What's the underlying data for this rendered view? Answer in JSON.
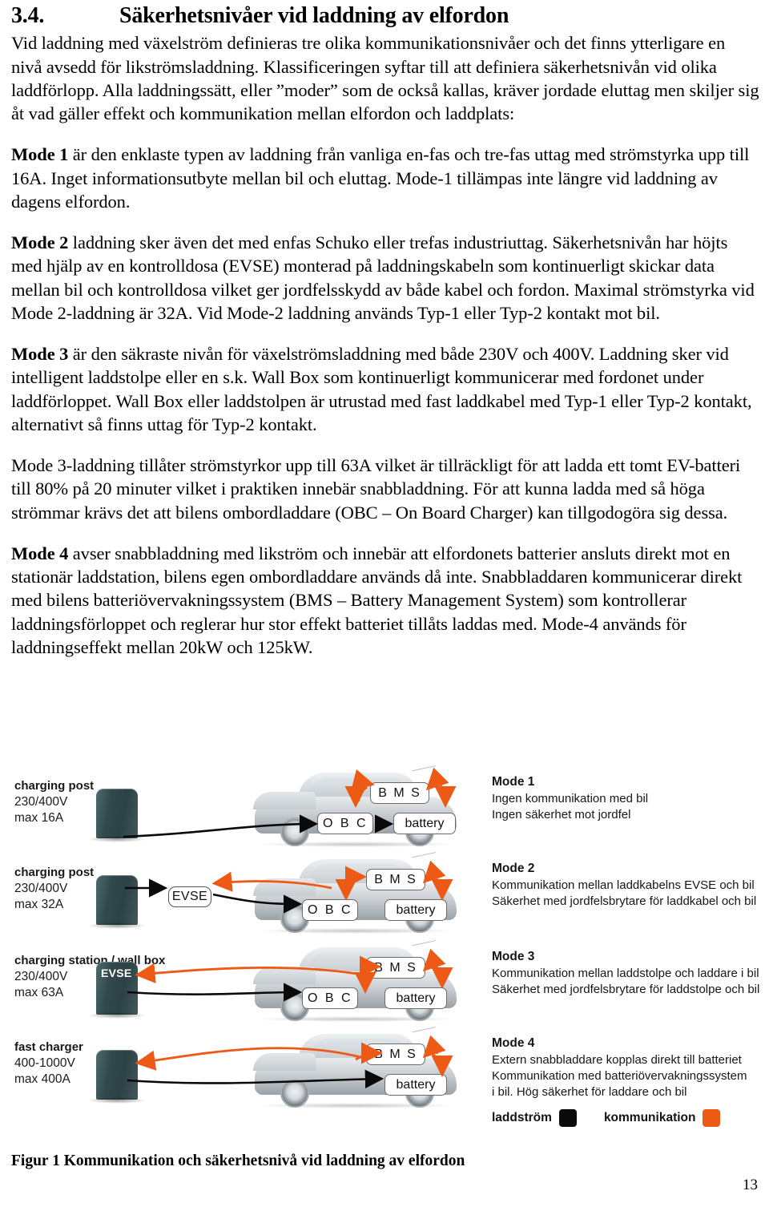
{
  "heading": {
    "number": "3.4.",
    "title": "Säkerhetsnivåer vid laddning av elfordon"
  },
  "body": {
    "intro": "Vid laddning med växelström definieras tre olika kommunikationsnivåer och det finns ytterligare en nivå avsedd för likströmsladdning. Klassificeringen syftar till att definiera säkerhetsnivån vid olika laddförlopp.  Alla laddningssätt, eller ”moder” som de också kallas, kräver jordade eluttag men skiljer sig åt vad gäller effekt och kommunikation mellan elfordon och laddplats:",
    "mode1_label": "Mode 1",
    "mode1_text": " är den enklaste typen av laddning från vanliga en-fas och tre-fas uttag med strömstyrka upp till 16A. Inget informationsutbyte mellan bil och eluttag. Mode-1 tillämpas inte längre vid laddning av dagens elfordon.",
    "mode2_label": "Mode 2",
    "mode2_text": " laddning sker även det med enfas Schuko eller trefas industriuttag. Säkerhetsnivån har höjts med hjälp av en kontrolldosa (EVSE) monterad på laddningskabeln som kontinuerligt skickar data mellan bil och kontrolldosa vilket ger jordfelsskydd av både kabel och fordon. Maximal strömstyrka vid Mode 2-laddning är 32A. Vid Mode-2 laddning används Typ-1 eller Typ-2 kontakt mot bil.",
    "mode3_label": "Mode 3",
    "mode3_text": " är den säkraste nivån för växelströmsladdning med både 230V och 400V. Laddning sker vid intelligent laddstolpe eller en s.k. Wall Box som kontinuerligt kommunicerar med fordonet under laddförloppet. Wall Box eller laddstolpen är utrustad med fast laddkabel med Typ-1 eller Typ-2 kontakt, alternativt så finns uttag för Typ-2 kontakt.",
    "mode3b_text": "Mode 3-laddning tillåter strömstyrkor upp till 63A vilket är tillräckligt för att ladda ett tomt EV-batteri till 80% på 20 minuter vilket i praktiken innebär snabbladdning. För att kunna ladda med så höga strömmar krävs det att bilens ombordladdare (OBC – On Board Charger) kan tillgodogöra sig dessa.",
    "mode4_label": "Mode 4",
    "mode4_text": " avser snabbladdning med likström och innebär att elfordonets batterier ansluts direkt mot en stationär laddstation, bilens egen ombordladdare används då inte. Snabbladdaren kommunicerar direkt med bilens batteriövervakningssystem (BMS – Battery Management System) som kontrollerar laddningsförloppet och reglerar hur stor effekt batteriet tillåts laddas med. Mode-4 används för laddningseffekt mellan 20kW och 125kW."
  },
  "figure": {
    "caption": "Figur 1 Kommunikation och säkerhetsnivå vid laddning av elfordon",
    "rows": [
      {
        "source_title": "charging post",
        "source_spec_1": "230/400V",
        "source_spec_2": "max 16A",
        "evse_on_post": "",
        "evse_pill": "",
        "car_components": [
          "B M S",
          "O B C",
          "battery"
        ],
        "mode_title": "Mode 1",
        "mode_lines": [
          "Ingen kommunikation med bil",
          "Ingen säkerhet mot jordfel"
        ]
      },
      {
        "source_title": "charging post",
        "source_spec_1": "230/400V",
        "source_spec_2": "max 32A",
        "evse_on_post": "",
        "evse_pill": "EVSE",
        "car_components": [
          "B M S",
          "O B C",
          "battery"
        ],
        "mode_title": "Mode 2",
        "mode_lines": [
          "Kommunikation mellan laddkabelns EVSE och bil",
          "Säkerhet med jordfelsbrytare för laddkabel och bil"
        ]
      },
      {
        "source_title": "charging station / wall box",
        "source_spec_1": "230/400V",
        "source_spec_2": "max 63A",
        "evse_on_post": "EVSE",
        "evse_pill": "",
        "car_components": [
          "B M S",
          "O B C",
          "battery"
        ],
        "mode_title": "Mode 3",
        "mode_lines": [
          "Kommunikation mellan laddstolpe och laddare i bil",
          "Säkerhet med jordfelsbrytare för laddstolpe och bil"
        ]
      },
      {
        "source_title": "fast charger",
        "source_spec_1": "400-1000V",
        "source_spec_2": "max 400A",
        "evse_on_post": "",
        "evse_pill": "",
        "car_components": [
          "B M S",
          "battery"
        ],
        "mode_title": "Mode 4",
        "mode_lines": [
          "Extern snabbladdare kopplas direkt till batteriet",
          "Kommunikation med batteriövervakningssystem",
          "i bil. Hög säkerhet för laddare och bil"
        ]
      }
    ],
    "legend": {
      "current_label": "laddström",
      "current_color": "#0a0a0a",
      "comm_label": "kommunikation",
      "comm_color": "#ec5a16"
    }
  },
  "page_number": "13"
}
